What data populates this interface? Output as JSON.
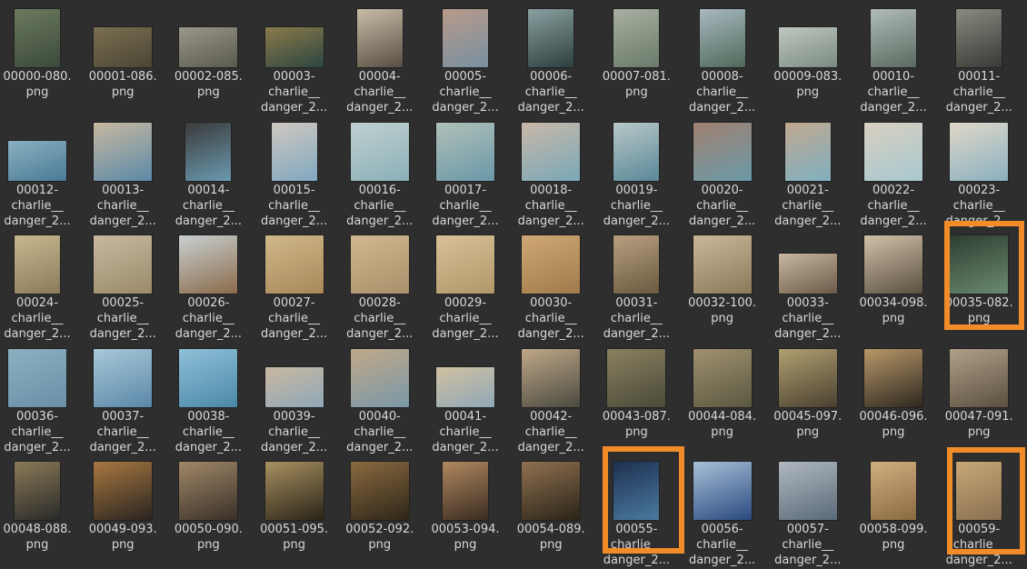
{
  "highlight_color": "#f28c28",
  "highlighted_files": [
    "00035-082.png",
    "00055-charlie__danger_2...",
    "00059-charlie__danger_2..."
  ],
  "files": [
    {
      "line1": "00000-080.",
      "line2": "png",
      "line3": "",
      "colors": [
        "#3c4a3c",
        "#6b7a5e"
      ],
      "shape": "portrait"
    },
    {
      "line1": "00001-086.",
      "line2": "png",
      "line3": "",
      "colors": [
        "#4a4634",
        "#7b6e50"
      ],
      "shape": "wide"
    },
    {
      "line1": "00002-085.",
      "line2": "png",
      "line3": "",
      "colors": [
        "#5a5a4e",
        "#9a968a"
      ],
      "shape": "wide"
    },
    {
      "line1": "00003-",
      "line2": "charlie__",
      "line3": "danger_2...",
      "colors": [
        "#2d4640",
        "#8a7a4a"
      ],
      "shape": "wide"
    },
    {
      "line1": "00004-",
      "line2": "charlie__",
      "line3": "danger_2...",
      "colors": [
        "#5a4e44",
        "#c8bca8"
      ],
      "shape": "portrait"
    },
    {
      "line1": "00005-",
      "line2": "charlie__",
      "line3": "danger_2...",
      "colors": [
        "#7890a0",
        "#b89a8a"
      ],
      "shape": "portrait"
    },
    {
      "line1": "00006-",
      "line2": "charlie__",
      "line3": "danger_2...",
      "colors": [
        "#2e3e3e",
        "#8aa0a0"
      ],
      "shape": "portrait"
    },
    {
      "line1": "00007-081.",
      "line2": "png",
      "line3": "",
      "colors": [
        "#6a7a6a",
        "#a8b0a0"
      ],
      "shape": "portrait"
    },
    {
      "line1": "00008-",
      "line2": "charlie__",
      "line3": "danger_2...",
      "colors": [
        "#4e6a5a",
        "#a8b8c0"
      ],
      "shape": "portrait"
    },
    {
      "line1": "00009-083.",
      "line2": "png",
      "line3": "",
      "colors": [
        "#7a8a80",
        "#c0c8c0"
      ],
      "shape": "wide"
    },
    {
      "line1": "00010-",
      "line2": "charlie__",
      "line3": "danger_2...",
      "colors": [
        "#5a6a60",
        "#b0bcb8"
      ],
      "shape": "portrait"
    },
    {
      "line1": "00011-",
      "line2": "charlie__",
      "line3": "danger_2...",
      "colors": [
        "#3a3a36",
        "#8a8a82"
      ],
      "shape": "portrait"
    },
    {
      "line1": "00012-",
      "line2": "charlie__",
      "line3": "danger_2...",
      "colors": [
        "#4a7a96",
        "#8ab0c0"
      ],
      "shape": "wide"
    },
    {
      "line1": "00013-",
      "line2": "charlie__",
      "line3": "danger_2...",
      "colors": [
        "#5a8aa8",
        "#c8b8a0"
      ],
      "shape": "square"
    },
    {
      "line1": "00014-",
      "line2": "charlie__",
      "line3": "danger_2...",
      "colors": [
        "#6a9ab0",
        "#3a3a3a"
      ],
      "shape": "portrait"
    },
    {
      "line1": "00015-",
      "line2": "charlie__",
      "line3": "danger_2...",
      "colors": [
        "#80a8c0",
        "#d0c8c0"
      ],
      "shape": "portrait"
    },
    {
      "line1": "00016-",
      "line2": "charlie__",
      "line3": "danger_2...",
      "colors": [
        "#8ab0b8",
        "#c0d0d0"
      ],
      "shape": "square"
    },
    {
      "line1": "00017-",
      "line2": "charlie__",
      "line3": "danger_2...",
      "colors": [
        "#6a98a8",
        "#b0c0b8"
      ],
      "shape": "square"
    },
    {
      "line1": "00018-",
      "line2": "charlie__",
      "line3": "danger_2...",
      "colors": [
        "#7aa8b8",
        "#c8b8a8"
      ],
      "shape": "square"
    },
    {
      "line1": "00019-",
      "line2": "charlie__",
      "line3": "danger_2...",
      "colors": [
        "#5a8898",
        "#b8c8c8"
      ],
      "shape": "portrait"
    },
    {
      "line1": "00020-",
      "line2": "charlie__",
      "line3": "danger_2...",
      "colors": [
        "#6a9aa8",
        "#a08070"
      ],
      "shape": "square"
    },
    {
      "line1": "00021-",
      "line2": "charlie__",
      "line3": "danger_2...",
      "colors": [
        "#80b0c0",
        "#c0a890"
      ],
      "shape": "portrait"
    },
    {
      "line1": "00022-",
      "line2": "charlie__",
      "line3": "danger_2...",
      "colors": [
        "#a8c8d0",
        "#d8d0c0"
      ],
      "shape": "square"
    },
    {
      "line1": "00023-",
      "line2": "charlie__",
      "line3": "danger_2...",
      "colors": [
        "#8ab0c0",
        "#e0d8c8"
      ],
      "shape": "square"
    },
    {
      "line1": "00024-",
      "line2": "charlie__",
      "line3": "danger_2...",
      "colors": [
        "#8a7a5a",
        "#c8b890"
      ],
      "shape": "portrait"
    },
    {
      "line1": "00025-",
      "line2": "charlie__",
      "line3": "danger_2...",
      "colors": [
        "#9a8a6a",
        "#c8b8a0"
      ],
      "shape": "square"
    },
    {
      "line1": "00026-",
      "line2": "charlie__",
      "line3": "danger_2...",
      "colors": [
        "#8a6a4a",
        "#c8d0d0"
      ],
      "shape": "square"
    },
    {
      "line1": "00027-",
      "line2": "charlie__",
      "line3": "danger_2...",
      "colors": [
        "#a8885a",
        "#d0b888"
      ],
      "shape": "square"
    },
    {
      "line1": "00028-",
      "line2": "charlie__",
      "line3": "danger_2...",
      "colors": [
        "#a8906a",
        "#d0b890"
      ],
      "shape": "square"
    },
    {
      "line1": "00029-",
      "line2": "charlie__",
      "line3": "danger_2...",
      "colors": [
        "#b0986a",
        "#d8c098"
      ],
      "shape": "square"
    },
    {
      "line1": "00030-",
      "line2": "charlie__",
      "line3": "danger_2...",
      "colors": [
        "#a07a4a",
        "#d0a878"
      ],
      "shape": "square"
    },
    {
      "line1": "00031-",
      "line2": "charlie__",
      "line3": "danger_2...",
      "colors": [
        "#6a5a40",
        "#b8a080"
      ],
      "shape": "portrait"
    },
    {
      "line1": "00032-100.",
      "line2": "png",
      "line3": "",
      "colors": [
        "#8a7a5a",
        "#c8b898"
      ],
      "shape": "square"
    },
    {
      "line1": "00033-",
      "line2": "charlie__",
      "line3": "danger_2...",
      "colors": [
        "#6a5a48",
        "#c8b8a0"
      ],
      "shape": "wide"
    },
    {
      "line1": "00034-098.",
      "line2": "png",
      "line3": "",
      "colors": [
        "#5a5040",
        "#d0c0a8"
      ],
      "shape": "square"
    },
    {
      "line1": "00035-082.",
      "line2": "png",
      "line3": "",
      "colors": [
        "#6a8a70",
        "#2e3e30"
      ],
      "shape": "square"
    },
    {
      "line1": "00036-",
      "line2": "charlie__",
      "line3": "danger_2...",
      "colors": [
        "#6a90a8",
        "#8ab0c0"
      ],
      "shape": "square"
    },
    {
      "line1": "00037-",
      "line2": "charlie__",
      "line3": "danger_2...",
      "colors": [
        "#5a88a8",
        "#a8c8d8"
      ],
      "shape": "square"
    },
    {
      "line1": "00038-",
      "line2": "charlie__",
      "line3": "danger_2...",
      "colors": [
        "#4a88a8",
        "#90c0d8"
      ],
      "shape": "square"
    },
    {
      "line1": "00039-",
      "line2": "charlie__",
      "line3": "danger_2...",
      "colors": [
        "#90a8b8",
        "#c8b8a0"
      ],
      "shape": "wide"
    },
    {
      "line1": "00040-",
      "line2": "charlie__",
      "line3": "danger_2...",
      "colors": [
        "#7a98a8",
        "#c0a888"
      ],
      "shape": "square"
    },
    {
      "line1": "00041-",
      "line2": "charlie__",
      "line3": "danger_2...",
      "colors": [
        "#90a8b8",
        "#d0c0a0"
      ],
      "shape": "wide"
    },
    {
      "line1": "00042-",
      "line2": "charlie__",
      "line3": "danger_2...",
      "colors": [
        "#4a4a40",
        "#c0a888"
      ],
      "shape": "square"
    },
    {
      "line1": "00043-087.",
      "line2": "png",
      "line3": "",
      "colors": [
        "#4a4a38",
        "#8a8060"
      ],
      "shape": "square"
    },
    {
      "line1": "00044-084.",
      "line2": "png",
      "line3": "",
      "colors": [
        "#5a5840",
        "#a09070"
      ],
      "shape": "square"
    },
    {
      "line1": "00045-097.",
      "line2": "png",
      "line3": "",
      "colors": [
        "#4a4030",
        "#b0a070"
      ],
      "shape": "square"
    },
    {
      "line1": "00046-096.",
      "line2": "png",
      "line3": "",
      "colors": [
        "#2e2820",
        "#b89868"
      ],
      "shape": "square"
    },
    {
      "line1": "00047-091.",
      "line2": "png",
      "line3": "",
      "colors": [
        "#5a5040",
        "#b0a088"
      ],
      "shape": "square"
    },
    {
      "line1": "00048-088.",
      "line2": "png",
      "line3": "",
      "colors": [
        "#2a2a28",
        "#8a7a58"
      ],
      "shape": "portrait"
    },
    {
      "line1": "00049-093.",
      "line2": "png",
      "line3": "",
      "colors": [
        "#2a2420",
        "#a87840"
      ],
      "shape": "square"
    },
    {
      "line1": "00050-090.",
      "line2": "png",
      "line3": "",
      "colors": [
        "#3a3028",
        "#a08868"
      ],
      "shape": "square"
    },
    {
      "line1": "00051-095.",
      "line2": "png",
      "line3": "",
      "colors": [
        "#2a2418",
        "#a89060"
      ],
      "shape": "square"
    },
    {
      "line1": "00052-092.",
      "line2": "png",
      "line3": "",
      "colors": [
        "#2e2618",
        "#8a6a40"
      ],
      "shape": "square"
    },
    {
      "line1": "00053-094.",
      "line2": "png",
      "line3": "",
      "colors": [
        "#3a2c20",
        "#b08860"
      ],
      "shape": "portrait"
    },
    {
      "line1": "00054-089.",
      "line2": "png",
      "line3": "",
      "colors": [
        "#2a2418",
        "#907050"
      ],
      "shape": "square"
    },
    {
      "line1": "00055-",
      "line2": "charlie__",
      "line3": "danger_2...",
      "colors": [
        "#4a7aa0",
        "#1e3050"
      ],
      "shape": "portrait"
    },
    {
      "line1": "00056-",
      "line2": "charlie__",
      "line3": "danger_2...",
      "colors": [
        "#2a4a80",
        "#a8c0d8"
      ],
      "shape": "square"
    },
    {
      "line1": "00057-",
      "line2": "charlie__",
      "line3": "danger_2...",
      "colors": [
        "#5a6a78",
        "#b0b8c0"
      ],
      "shape": "square"
    },
    {
      "line1": "00058-099.",
      "line2": "png",
      "line3": "",
      "colors": [
        "#8a6a40",
        "#d0b080"
      ],
      "shape": "portrait"
    },
    {
      "line1": "00059-",
      "line2": "charlie__",
      "line3": "danger_2...",
      "colors": [
        "#8a7050",
        "#c8a878"
      ],
      "shape": "portrait"
    }
  ]
}
